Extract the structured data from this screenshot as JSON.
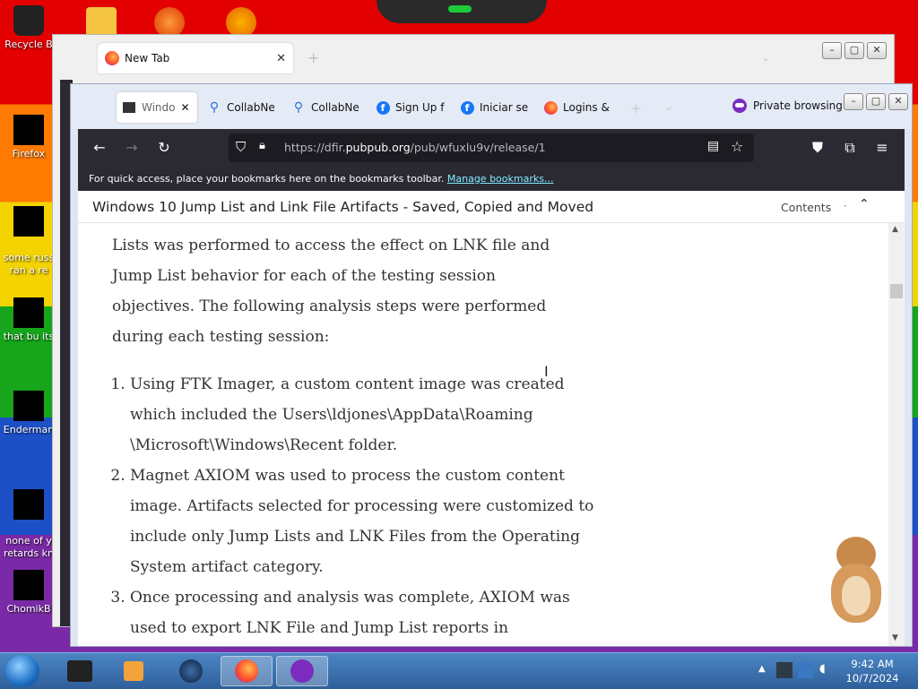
{
  "desktop": {
    "icons": [
      {
        "label": "Recycle B"
      },
      {
        "label": "Firefox"
      },
      {
        "label": "some russ\nran a re"
      },
      {
        "label": "that bu its"
      },
      {
        "label": "Enderman"
      },
      {
        "label": "none of y\nretards kn"
      },
      {
        "label": "ChomikB"
      }
    ]
  },
  "back_window": {
    "tab_title": "New Tab"
  },
  "browser": {
    "tabs": [
      {
        "label": "Windo"
      },
      {
        "label": "CollabNe"
      },
      {
        "label": "CollabNe"
      },
      {
        "label": "Sign Up f"
      },
      {
        "label": "Iniciar se"
      },
      {
        "label": "Logins &"
      }
    ],
    "private_label": "Private browsing",
    "url_prefix": "https://dfir.",
    "url_domain": "pubpub.org",
    "url_path": "/pub/wfuxlu9v/release/1",
    "bookmarks_hint": "For quick access, place your bookmarks here on the bookmarks toolbar.",
    "manage_bookmarks": "Manage bookmarks...",
    "page_title": "Windows 10 Jump List and Link File Artifacts - Saved, Copied and Moved",
    "contents_label": "Contents",
    "contents_sep": "·"
  },
  "article": {
    "paragraph": "Lists was performed to access the effect on LNK file and Jump List behavior for each of the testing session objectives. The following analysis steps were performed during each testing session:",
    "steps": [
      "Using FTK Imager, a custom content image was created which included the Users\\ldjones\\AppData\\Roaming \\Microsoft\\Windows\\Recent folder.",
      "Magnet AXIOM was used to process the custom content image. Artifacts selected for processing were customized to include only Jump Lists and LNK Files from the Operating System artifact category.",
      "Once processing and analysis was complete, AXIOM was used to export LNK File and Jump List reports in"
    ]
  },
  "taskbar": {
    "time": "9:42 AM",
    "date": "10/7/2024"
  },
  "colors": {
    "firefox_dark": "#2b2a33",
    "link": "#80ebff",
    "private_purple": "#8a2be2"
  }
}
